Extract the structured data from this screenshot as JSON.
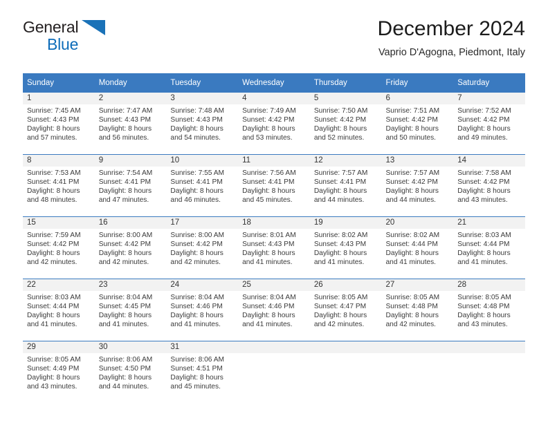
{
  "brand": {
    "name_top": "General",
    "name_bottom": "Blue",
    "triangle_icon": "brand-triangle-icon",
    "color_text": "#231f20",
    "color_blue": "#0d6cb9"
  },
  "header": {
    "title": "December 2024",
    "subtitle": "Vaprio D'Agogna, Piedmont, Italy"
  },
  "theme": {
    "header_bg": "#3a7ac0",
    "header_text": "#ffffff",
    "daynum_bg": "#f2f2f2",
    "body_text": "#3a3a3a",
    "row_border": "#3a7ac0"
  },
  "calendar": {
    "weekday_headers": [
      "Sunday",
      "Monday",
      "Tuesday",
      "Wednesday",
      "Thursday",
      "Friday",
      "Saturday"
    ],
    "labels": {
      "sunrise_prefix": "Sunrise:",
      "sunset_prefix": "Sunset:",
      "daylight_prefix": "Daylight:"
    },
    "weeks": [
      [
        {
          "day": "1",
          "sunrise": "Sunrise: 7:45 AM",
          "sunset": "Sunset: 4:43 PM",
          "daylight_l1": "Daylight: 8 hours",
          "daylight_l2": "and 57 minutes."
        },
        {
          "day": "2",
          "sunrise": "Sunrise: 7:47 AM",
          "sunset": "Sunset: 4:43 PM",
          "daylight_l1": "Daylight: 8 hours",
          "daylight_l2": "and 56 minutes."
        },
        {
          "day": "3",
          "sunrise": "Sunrise: 7:48 AM",
          "sunset": "Sunset: 4:43 PM",
          "daylight_l1": "Daylight: 8 hours",
          "daylight_l2": "and 54 minutes."
        },
        {
          "day": "4",
          "sunrise": "Sunrise: 7:49 AM",
          "sunset": "Sunset: 4:42 PM",
          "daylight_l1": "Daylight: 8 hours",
          "daylight_l2": "and 53 minutes."
        },
        {
          "day": "5",
          "sunrise": "Sunrise: 7:50 AM",
          "sunset": "Sunset: 4:42 PM",
          "daylight_l1": "Daylight: 8 hours",
          "daylight_l2": "and 52 minutes."
        },
        {
          "day": "6",
          "sunrise": "Sunrise: 7:51 AM",
          "sunset": "Sunset: 4:42 PM",
          "daylight_l1": "Daylight: 8 hours",
          "daylight_l2": "and 50 minutes."
        },
        {
          "day": "7",
          "sunrise": "Sunrise: 7:52 AM",
          "sunset": "Sunset: 4:42 PM",
          "daylight_l1": "Daylight: 8 hours",
          "daylight_l2": "and 49 minutes."
        }
      ],
      [
        {
          "day": "8",
          "sunrise": "Sunrise: 7:53 AM",
          "sunset": "Sunset: 4:41 PM",
          "daylight_l1": "Daylight: 8 hours",
          "daylight_l2": "and 48 minutes."
        },
        {
          "day": "9",
          "sunrise": "Sunrise: 7:54 AM",
          "sunset": "Sunset: 4:41 PM",
          "daylight_l1": "Daylight: 8 hours",
          "daylight_l2": "and 47 minutes."
        },
        {
          "day": "10",
          "sunrise": "Sunrise: 7:55 AM",
          "sunset": "Sunset: 4:41 PM",
          "daylight_l1": "Daylight: 8 hours",
          "daylight_l2": "and 46 minutes."
        },
        {
          "day": "11",
          "sunrise": "Sunrise: 7:56 AM",
          "sunset": "Sunset: 4:41 PM",
          "daylight_l1": "Daylight: 8 hours",
          "daylight_l2": "and 45 minutes."
        },
        {
          "day": "12",
          "sunrise": "Sunrise: 7:57 AM",
          "sunset": "Sunset: 4:41 PM",
          "daylight_l1": "Daylight: 8 hours",
          "daylight_l2": "and 44 minutes."
        },
        {
          "day": "13",
          "sunrise": "Sunrise: 7:57 AM",
          "sunset": "Sunset: 4:42 PM",
          "daylight_l1": "Daylight: 8 hours",
          "daylight_l2": "and 44 minutes."
        },
        {
          "day": "14",
          "sunrise": "Sunrise: 7:58 AM",
          "sunset": "Sunset: 4:42 PM",
          "daylight_l1": "Daylight: 8 hours",
          "daylight_l2": "and 43 minutes."
        }
      ],
      [
        {
          "day": "15",
          "sunrise": "Sunrise: 7:59 AM",
          "sunset": "Sunset: 4:42 PM",
          "daylight_l1": "Daylight: 8 hours",
          "daylight_l2": "and 42 minutes."
        },
        {
          "day": "16",
          "sunrise": "Sunrise: 8:00 AM",
          "sunset": "Sunset: 4:42 PM",
          "daylight_l1": "Daylight: 8 hours",
          "daylight_l2": "and 42 minutes."
        },
        {
          "day": "17",
          "sunrise": "Sunrise: 8:00 AM",
          "sunset": "Sunset: 4:42 PM",
          "daylight_l1": "Daylight: 8 hours",
          "daylight_l2": "and 42 minutes."
        },
        {
          "day": "18",
          "sunrise": "Sunrise: 8:01 AM",
          "sunset": "Sunset: 4:43 PM",
          "daylight_l1": "Daylight: 8 hours",
          "daylight_l2": "and 41 minutes."
        },
        {
          "day": "19",
          "sunrise": "Sunrise: 8:02 AM",
          "sunset": "Sunset: 4:43 PM",
          "daylight_l1": "Daylight: 8 hours",
          "daylight_l2": "and 41 minutes."
        },
        {
          "day": "20",
          "sunrise": "Sunrise: 8:02 AM",
          "sunset": "Sunset: 4:44 PM",
          "daylight_l1": "Daylight: 8 hours",
          "daylight_l2": "and 41 minutes."
        },
        {
          "day": "21",
          "sunrise": "Sunrise: 8:03 AM",
          "sunset": "Sunset: 4:44 PM",
          "daylight_l1": "Daylight: 8 hours",
          "daylight_l2": "and 41 minutes."
        }
      ],
      [
        {
          "day": "22",
          "sunrise": "Sunrise: 8:03 AM",
          "sunset": "Sunset: 4:44 PM",
          "daylight_l1": "Daylight: 8 hours",
          "daylight_l2": "and 41 minutes."
        },
        {
          "day": "23",
          "sunrise": "Sunrise: 8:04 AM",
          "sunset": "Sunset: 4:45 PM",
          "daylight_l1": "Daylight: 8 hours",
          "daylight_l2": "and 41 minutes."
        },
        {
          "day": "24",
          "sunrise": "Sunrise: 8:04 AM",
          "sunset": "Sunset: 4:46 PM",
          "daylight_l1": "Daylight: 8 hours",
          "daylight_l2": "and 41 minutes."
        },
        {
          "day": "25",
          "sunrise": "Sunrise: 8:04 AM",
          "sunset": "Sunset: 4:46 PM",
          "daylight_l1": "Daylight: 8 hours",
          "daylight_l2": "and 41 minutes."
        },
        {
          "day": "26",
          "sunrise": "Sunrise: 8:05 AM",
          "sunset": "Sunset: 4:47 PM",
          "daylight_l1": "Daylight: 8 hours",
          "daylight_l2": "and 42 minutes."
        },
        {
          "day": "27",
          "sunrise": "Sunrise: 8:05 AM",
          "sunset": "Sunset: 4:48 PM",
          "daylight_l1": "Daylight: 8 hours",
          "daylight_l2": "and 42 minutes."
        },
        {
          "day": "28",
          "sunrise": "Sunrise: 8:05 AM",
          "sunset": "Sunset: 4:48 PM",
          "daylight_l1": "Daylight: 8 hours",
          "daylight_l2": "and 43 minutes."
        }
      ],
      [
        {
          "day": "29",
          "sunrise": "Sunrise: 8:05 AM",
          "sunset": "Sunset: 4:49 PM",
          "daylight_l1": "Daylight: 8 hours",
          "daylight_l2": "and 43 minutes."
        },
        {
          "day": "30",
          "sunrise": "Sunrise: 8:06 AM",
          "sunset": "Sunset: 4:50 PM",
          "daylight_l1": "Daylight: 8 hours",
          "daylight_l2": "and 44 minutes."
        },
        {
          "day": "31",
          "sunrise": "Sunrise: 8:06 AM",
          "sunset": "Sunset: 4:51 PM",
          "daylight_l1": "Daylight: 8 hours",
          "daylight_l2": "and 45 minutes."
        },
        {
          "day": "",
          "sunrise": "",
          "sunset": "",
          "daylight_l1": "",
          "daylight_l2": ""
        },
        {
          "day": "",
          "sunrise": "",
          "sunset": "",
          "daylight_l1": "",
          "daylight_l2": ""
        },
        {
          "day": "",
          "sunrise": "",
          "sunset": "",
          "daylight_l1": "",
          "daylight_l2": ""
        },
        {
          "day": "",
          "sunrise": "",
          "sunset": "",
          "daylight_l1": "",
          "daylight_l2": ""
        }
      ]
    ]
  }
}
